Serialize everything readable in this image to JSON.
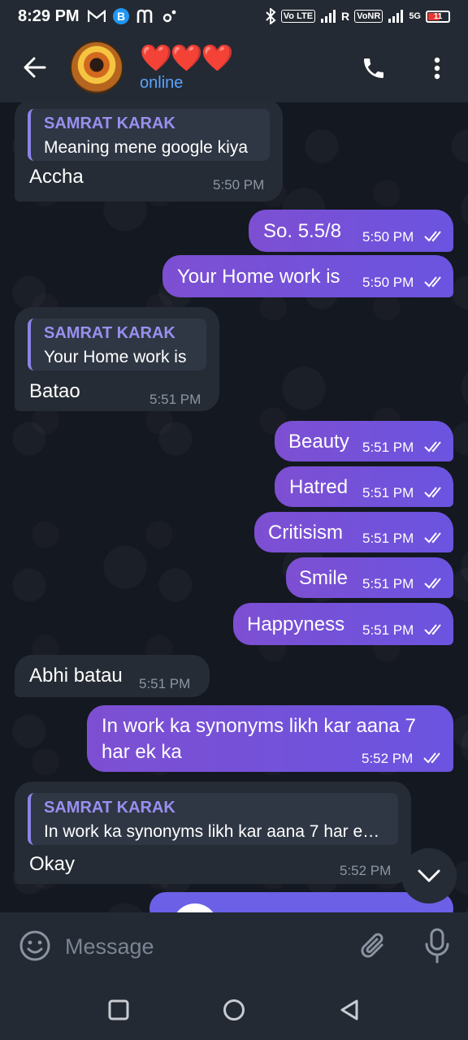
{
  "status_bar": {
    "time": "8:29 PM",
    "icons": [
      "gmail-icon",
      "b-icon",
      "m-icon",
      "settings-icon"
    ],
    "bluetooth": "bluetooth-icon",
    "volte": "Vo LTE",
    "roaming": "R",
    "vonr": "VoNR",
    "network": "5G",
    "battery_level": "11"
  },
  "header": {
    "contact_name": "❤️❤️❤️",
    "status": "online"
  },
  "messages": [
    {
      "direction": "in",
      "reply_name": "SAMRAT KARAK",
      "reply_text": "Meaning mene google kiya",
      "text": "Accha",
      "time": "5:50 PM"
    },
    {
      "direction": "out",
      "text": "So.  5.5/8",
      "time": "5:50 PM",
      "read": true
    },
    {
      "direction": "out",
      "text": "Your Home work is",
      "time": "5:50 PM",
      "read": true
    },
    {
      "direction": "in",
      "reply_name": "SAMRAT KARAK",
      "reply_text": "Your Home work is",
      "text": "Batao",
      "time": "5:51 PM"
    },
    {
      "direction": "out",
      "text": "Beauty",
      "time": "5:51 PM",
      "read": true
    },
    {
      "direction": "out",
      "text": "Hatred",
      "time": "5:51 PM",
      "read": true
    },
    {
      "direction": "out",
      "text": "Critisism",
      "time": "5:51 PM",
      "read": true
    },
    {
      "direction": "out",
      "text": "Smile",
      "time": "5:51 PM",
      "read": true
    },
    {
      "direction": "out",
      "text": "Happyness",
      "time": "5:51 PM",
      "read": true
    },
    {
      "direction": "in",
      "text": "Abhi batau",
      "time": "5:51 PM"
    },
    {
      "direction": "out",
      "text_line1": "In work ka synonyms likh kar aana 7",
      "text_line2": "har ek ka",
      "time": "5:52 PM",
      "read": true
    },
    {
      "direction": "in",
      "reply_name": "SAMRAT KARAK",
      "reply_text": "In work ka synonyms likh kar aana 7 har e…",
      "text": "Okay",
      "time": "5:52 PM"
    }
  ],
  "input": {
    "placeholder": "Message",
    "value": ""
  },
  "colors": {
    "outgoing_bubble": "#7d4fd2",
    "incoming_bubble": "#262c35",
    "header": "#242a33",
    "online": "#5aa4ff",
    "reply_name": "#9a8ff0"
  }
}
